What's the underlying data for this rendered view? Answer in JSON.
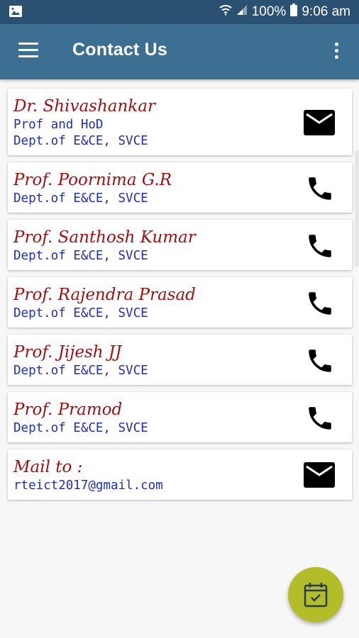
{
  "status": {
    "battery": "100%",
    "time": "9:06 am"
  },
  "header": {
    "title": "Contact Us"
  },
  "contacts": [
    {
      "name": "Dr. Shivashankar",
      "line1": "Prof and HoD",
      "line2": "Dept.of E&CE, SVCE",
      "icon": "mail-icon"
    },
    {
      "name": "Prof. Poornima G.R",
      "line1": "Dept.of E&CE, SVCE",
      "icon": "phone-icon"
    },
    {
      "name": "Prof. Santhosh Kumar",
      "line1": "Dept.of E&CE, SVCE",
      "icon": "phone-icon"
    },
    {
      "name": "Prof. Rajendra Prasad",
      "line1": "Dept.of E&CE, SVCE",
      "icon": "phone-icon"
    },
    {
      "name": "Prof. Jijesh JJ",
      "line1": "Dept.of E&CE, SVCE",
      "icon": "phone-icon"
    },
    {
      "name": "Prof. Pramod",
      "line1": "Dept.of E&CE, SVCE",
      "icon": "phone-icon"
    },
    {
      "name": "Mail to :",
      "line1": "rteict2017@gmail.com",
      "icon": "mail-icon"
    }
  ],
  "fab": {
    "icon": "calendar-check-icon",
    "color": "#b3bd27"
  },
  "colors": {
    "statusbar": "#2b5172",
    "appbar": "#3c6f92",
    "name_text": "#a11010",
    "detail_text": "#1f2fb8"
  }
}
